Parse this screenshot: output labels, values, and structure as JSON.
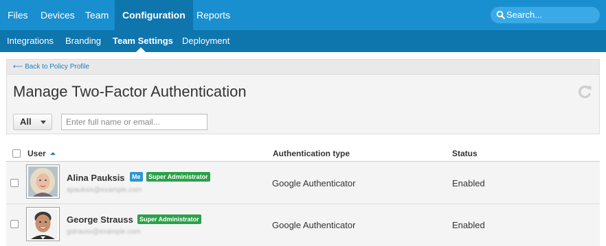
{
  "top_nav": {
    "items": [
      {
        "label": "Files"
      },
      {
        "label": "Devices"
      },
      {
        "label": "Team"
      },
      {
        "label": "Configuration"
      },
      {
        "label": "Reports"
      }
    ],
    "active": "Configuration",
    "search_placeholder": "Search..."
  },
  "sub_nav": {
    "items": [
      {
        "label": "Integrations"
      },
      {
        "label": "Branding"
      },
      {
        "label": "Team Settings"
      },
      {
        "label": "Deployment"
      }
    ],
    "active": "Team Settings"
  },
  "page": {
    "back_link": "⟵ Back to Policy Profile",
    "title": "Manage Two-Factor Authentication",
    "filter_label": "All",
    "search_placeholder": "Enter full name or email..."
  },
  "table": {
    "columns": [
      "User",
      "Authentication type",
      "Status"
    ],
    "sorted_by": "User",
    "rows": [
      {
        "name": "Alina Pauksis",
        "badges": [
          "Me",
          "Super Administrator"
        ],
        "email": "apauksis@example.com",
        "auth_type": "Google Authenticator",
        "status": "Enabled",
        "avatar": "woman-portrait"
      },
      {
        "name": "George Strauss",
        "badges": [
          "Super Administrator"
        ],
        "email": "gstrauss@example.com",
        "auth_type": "Google Authenticator",
        "status": "Enabled",
        "avatar": "man-portrait"
      }
    ]
  },
  "colors": {
    "top_nav_bg": "#1a8fd0",
    "sub_nav_bg": "#0f75ad",
    "me_badge": "#2b95d6",
    "admin_badge": "#2ba14a",
    "link": "#1a7fc1"
  }
}
